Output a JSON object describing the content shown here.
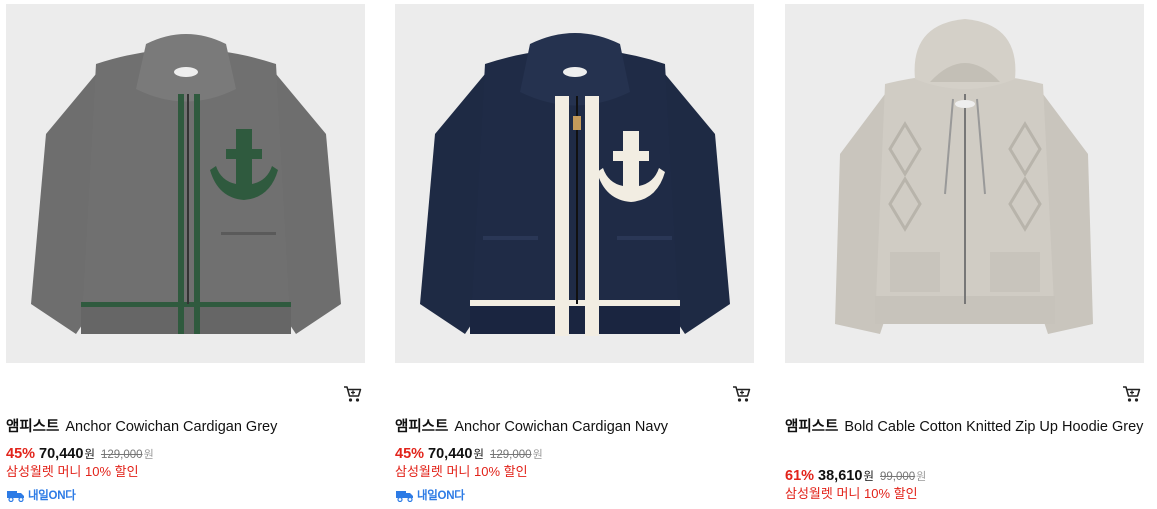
{
  "products": [
    {
      "brand": "앰피스트",
      "name": "Anchor Cowichan Cardigan Grey",
      "discount": "45%",
      "price": "70,440",
      "currency": "원",
      "original_price": "129,000",
      "original_currency": "원",
      "promo": "삼성월렛 머니 10% 할인",
      "delivery_badge": "내일ON다",
      "image_icon": "grey-cardigan-image",
      "colors": {
        "body": "#6e6e6e",
        "trim": "#2f5a3e",
        "anchor": "#2f5a3e"
      }
    },
    {
      "brand": "앰피스트",
      "name": "Anchor Cowichan Cardigan Navy",
      "discount": "45%",
      "price": "70,440",
      "currency": "원",
      "original_price": "129,000",
      "original_currency": "원",
      "promo": "삼성월렛 머니 10% 할인",
      "delivery_badge": "내일ON다",
      "image_icon": "navy-cardigan-image",
      "colors": {
        "body": "#1e2a44",
        "trim": "#f2ede2",
        "anchor": "#f2ede2"
      }
    },
    {
      "brand": "앰피스트",
      "name": "Bold Cable Cotton Knitted Zip Up Hoodie Grey",
      "discount": "61%",
      "price": "38,610",
      "currency": "원",
      "original_price": "99,000",
      "original_currency": "원",
      "promo": "삼성월렛 머니 10% 할인",
      "image_icon": "beige-hoodie-image",
      "colors": {
        "body": "#cfcbc3"
      }
    }
  ],
  "colors": {
    "discount": "#e2231a",
    "promo": "#e2231a",
    "badge": "#2d7be5",
    "image_bg": "#ececec"
  }
}
